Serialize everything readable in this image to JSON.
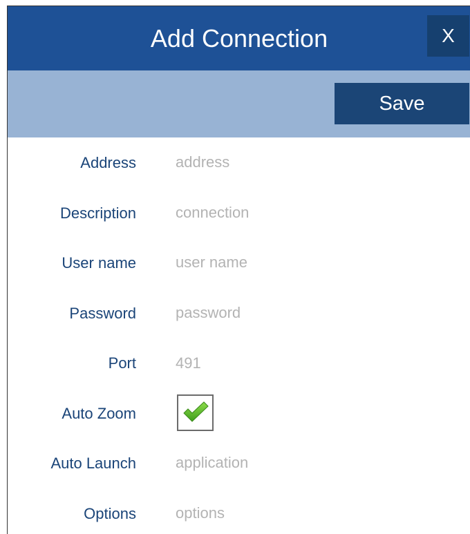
{
  "dialog": {
    "title": "Add Connection",
    "close_label": "X",
    "save_label": "Save"
  },
  "form": {
    "address": {
      "label": "Address",
      "placeholder": "address",
      "value": ""
    },
    "description": {
      "label": "Description",
      "placeholder": "connection",
      "value": ""
    },
    "user_name": {
      "label": "User name",
      "placeholder": "user name",
      "value": ""
    },
    "password": {
      "label": "Password",
      "placeholder": "password",
      "value": ""
    },
    "port": {
      "label": "Port",
      "value": "491"
    },
    "auto_zoom": {
      "label": "Auto Zoom",
      "checked": true,
      "icon": "checkmark-icon"
    },
    "auto_launch": {
      "label": "Auto Launch",
      "placeholder": "application",
      "value": ""
    },
    "options": {
      "label": "Options",
      "placeholder": "options",
      "value": ""
    }
  },
  "colors": {
    "titlebar": "#1e5196",
    "toolbar": "#98b3d4",
    "button": "#1b4576",
    "label": "#1a4478",
    "placeholder": "#b3b3b3",
    "check": "#5cbf2a"
  }
}
